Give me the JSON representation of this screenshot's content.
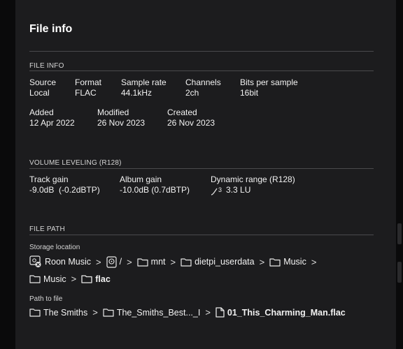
{
  "dialog": {
    "title": "File info"
  },
  "file_info": {
    "heading": "FILE INFO",
    "source": {
      "label": "Source",
      "value": "Local"
    },
    "format": {
      "label": "Format",
      "value": "FLAC"
    },
    "sample_rate": {
      "label": "Sample rate",
      "value": "44.1kHz"
    },
    "channels": {
      "label": "Channels",
      "value": "2ch"
    },
    "bits": {
      "label": "Bits per sample",
      "value": "16bit"
    },
    "added": {
      "label": "Added",
      "value": "12 Apr 2022"
    },
    "modified": {
      "label": "Modified",
      "value": "26 Nov 2023"
    },
    "created": {
      "label": "Created",
      "value": "26 Nov 2023"
    }
  },
  "volume": {
    "heading": "VOLUME LEVELING (R128)",
    "track_gain": {
      "label": "Track gain",
      "value": "-9.0dB  (-0.2dBTP)"
    },
    "album_gain": {
      "label": "Album gain",
      "value": "-10.0dB (0.7dBTP)"
    },
    "dynamic_range": {
      "label": "Dynamic range (R128)",
      "icon_text": "3",
      "value": "3.3 LU"
    }
  },
  "file_path": {
    "heading": "FILE PATH",
    "storage_label": "Storage location",
    "storage": {
      "roon": "Roon Music",
      "root": "/",
      "mnt": "mnt",
      "dietpi": "dietpi_userdata",
      "music1": "Music",
      "music2": "Music",
      "flac": "flac"
    },
    "path_label": "Path to file",
    "path": {
      "artist": "The Smiths",
      "album": "The_Smiths_Best..._I",
      "file": "01_This_Charming_Man.flac"
    }
  },
  "colors": {
    "panel": "#1c1c1e",
    "background": "#0f0f10",
    "text": "#f2f2f2",
    "rule": "#4a4a4d"
  }
}
